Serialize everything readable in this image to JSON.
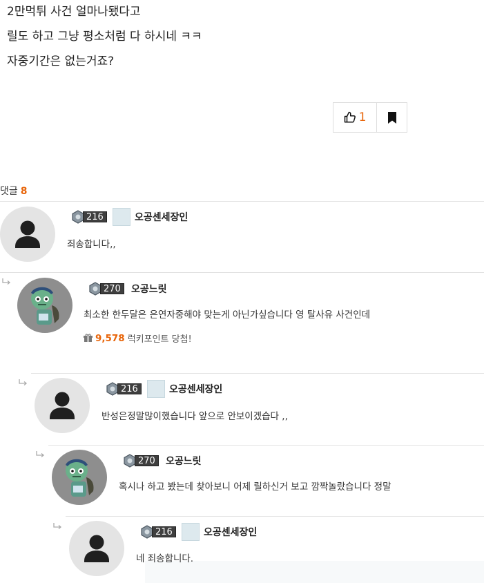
{
  "post": {
    "lines": [
      "2만먹튀 사건 얼마나됐다고",
      "릴도 하고 그냥 평소처럼 다 하시네 ㅋㅋ",
      "자중기간은 없는거죠?"
    ]
  },
  "actions": {
    "like_count": "1",
    "like_icon": "thumbs-up-icon",
    "bookmark_icon": "bookmark-icon",
    "accent_color": "#e8650a"
  },
  "comments_header": {
    "label": "댓글",
    "count": "8"
  },
  "comments": [
    {
      "level": "216",
      "nickname": "오공센세장인",
      "text": "죄송합니다,,",
      "avatar": "default-user-avatar"
    },
    {
      "level": "270",
      "nickname": "오공느릿",
      "text": "최소한 한두달은 은연자중해야 맞는게 아닌가싶습니다 영 탈사유 사건인데",
      "avatar": "zombie-character-avatar",
      "points": {
        "icon": "gift-icon",
        "value": "9,578",
        "label": "럭키포인트 당첨!"
      }
    },
    {
      "level": "216",
      "nickname": "오공센세장인",
      "text": "반성은정말많이했습니다 앞으로 안보이겠습다 ,,",
      "avatar": "default-user-avatar"
    },
    {
      "level": "270",
      "nickname": "오공느릿",
      "text": "혹시나 하고 봤는데 찾아보니 어제 릴하신거 보고 깜짝놀랐습니다 정말",
      "avatar": "zombie-character-avatar"
    },
    {
      "level": "216",
      "nickname": "오공센세장인",
      "text": "네 죄송합니다.",
      "avatar": "default-user-avatar"
    }
  ]
}
